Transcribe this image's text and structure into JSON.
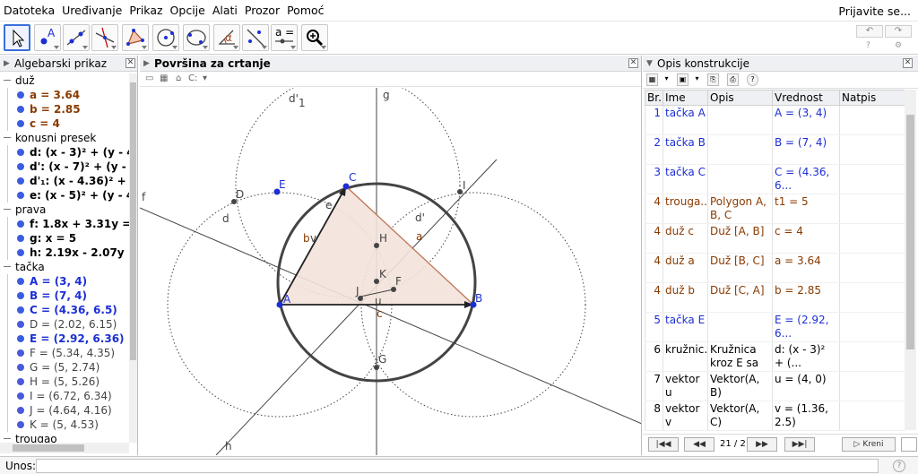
{
  "menu": {
    "items": [
      "Datoteka",
      "Uređivanje",
      "Prikaz",
      "Opcije",
      "Alati",
      "Prozor",
      "Pomoć"
    ],
    "signin": "Prijavite se..."
  },
  "toolbar": {
    "tools": [
      {
        "name": "move-tool-icon"
      },
      {
        "name": "point-tool-icon"
      },
      {
        "name": "line-tool-icon"
      },
      {
        "name": "perpendicular-tool-icon"
      },
      {
        "name": "polygon-tool-icon"
      },
      {
        "name": "circle-tool-icon"
      },
      {
        "name": "conic-tool-icon"
      },
      {
        "name": "angle-tool-icon"
      },
      {
        "name": "reflect-tool-icon"
      },
      {
        "name": "slider-tool-icon",
        "label": "a = 2"
      },
      {
        "name": "zoom-tool-icon"
      }
    ]
  },
  "algebra": {
    "title": "Algebarski prikaz",
    "rows": [
      {
        "kind": "cat",
        "text": "duž"
      },
      {
        "kind": "item",
        "text": "a = 3.64",
        "color": "#8a3a00"
      },
      {
        "kind": "item",
        "text": "b = 2.85",
        "color": "#8a3a00"
      },
      {
        "kind": "item",
        "text": "c = 4",
        "color": "#8a3a00"
      },
      {
        "kind": "cat",
        "text": "konusni presek"
      },
      {
        "kind": "item",
        "text": "d: (x - 3)² + (y - 4)² =",
        "color": "#000000"
      },
      {
        "kind": "item",
        "text": "d': (x - 7)² + (y - 4)² =",
        "color": "#000000"
      },
      {
        "kind": "item",
        "text": "d'₁: (x - 4.36)² + (y -",
        "color": "#000000"
      },
      {
        "kind": "item",
        "text": "e: (x - 5)² + (y - 4.53",
        "color": "#000000"
      },
      {
        "kind": "cat",
        "text": "prava"
      },
      {
        "kind": "item",
        "text": "f: 1.8x + 3.31y = 24.",
        "color": "#000000"
      },
      {
        "kind": "item",
        "text": "g: x = 5",
        "color": "#000000"
      },
      {
        "kind": "item",
        "text": "h: 2.19x - 2.07y = 1",
        "color": "#000000"
      },
      {
        "kind": "cat",
        "text": "tačka"
      },
      {
        "kind": "item",
        "text": "A = (3, 4)",
        "color": "#1c2fd4"
      },
      {
        "kind": "item",
        "text": "B = (7, 4)",
        "color": "#1c2fd4"
      },
      {
        "kind": "item",
        "text": "C = (4.36, 6.5)",
        "color": "#1c2fd4"
      },
      {
        "kind": "item",
        "text": "D = (2.02, 6.15)",
        "color": "#444444",
        "light": true
      },
      {
        "kind": "item",
        "text": "E = (2.92, 6.36)",
        "color": "#1c2fd4"
      },
      {
        "kind": "item",
        "text": "F = (5.34, 4.35)",
        "color": "#444444",
        "light": true
      },
      {
        "kind": "item",
        "text": "G = (5, 2.74)",
        "color": "#444444",
        "light": true
      },
      {
        "kind": "item",
        "text": "H = (5, 5.26)",
        "color": "#444444",
        "light": true
      },
      {
        "kind": "item",
        "text": "I = (6.72, 6.34)",
        "color": "#444444",
        "light": true
      },
      {
        "kind": "item",
        "text": "J = (4.64, 4.16)",
        "color": "#444444",
        "light": true
      },
      {
        "kind": "item",
        "text": "K = (5, 4.53)",
        "color": "#444444",
        "light": true
      },
      {
        "kind": "cat",
        "text": "trougao"
      }
    ]
  },
  "graphics": {
    "title": "Površina za crtanje",
    "style_label": "C:",
    "labels": {
      "A": "A",
      "B": "B",
      "C": "C",
      "D": "D",
      "E": "E",
      "F": "F",
      "G": "G",
      "H": "H",
      "I": "I",
      "J": "J",
      "K": "K",
      "a": "a",
      "b": "b",
      "c": "c",
      "d": "d",
      "d_prime": "d'",
      "d1": "d'",
      "d1_sub": "1",
      "e": "e",
      "f": "f",
      "g": "g",
      "h": "h",
      "u": "u",
      "v": "v"
    },
    "colors": {
      "point": "#1c2fd4",
      "triangle_fill": "#f3e3dc",
      "triangle_stroke": "#c07a5a",
      "circle": "#444444",
      "label_brown": "#8a3a00"
    }
  },
  "construction": {
    "title": "Opis konstrukcije",
    "columns": [
      "Br.",
      "Ime",
      "Opis",
      "Vrednost",
      "Natpis"
    ],
    "rows": [
      {
        "br": "1",
        "ime": "tačka A",
        "opis": "",
        "vrednost": "A = (3, 4)",
        "color": "c-blue"
      },
      {
        "br": "2",
        "ime": "tačka B",
        "opis": "",
        "vrednost": "B = (7, 4)",
        "color": "c-blue"
      },
      {
        "br": "3",
        "ime": "tačka C",
        "opis": "",
        "vrednost": "C = (4.36, 6...",
        "color": "c-blue"
      },
      {
        "br": "4",
        "ime": "trouga...",
        "opis": "Polygon A, B, C",
        "vrednost": "t1 = 5",
        "color": "c-brown"
      },
      {
        "br": "4",
        "ime": "duž c",
        "opis": "Duž [A, B]",
        "vrednost": "c = 4",
        "color": "c-brown"
      },
      {
        "br": "4",
        "ime": "duž a",
        "opis": "Duž [B, C]",
        "vrednost": "a = 3.64",
        "color": "c-brown"
      },
      {
        "br": "4",
        "ime": "duž b",
        "opis": "Duž [C, A]",
        "vrednost": "b = 2.85",
        "color": "c-brown"
      },
      {
        "br": "5",
        "ime": "tačka E",
        "opis": "",
        "vrednost": "E = (2.92, 6...",
        "color": "c-blue"
      },
      {
        "br": "6",
        "ime": "kružnic...",
        "opis": "Kružnica kroz E sa",
        "vrednost": "d: (x - 3)² + (...",
        "color": "c-black"
      },
      {
        "br": "7",
        "ime": "vektor u",
        "opis": "Vektor(A, B)",
        "vrednost": "u = (4, 0)",
        "color": "c-black"
      },
      {
        "br": "8",
        "ime": "vektor v",
        "opis": "Vektor(A, C)",
        "vrednost": "v = (1.36, 2.5)",
        "color": "c-black"
      }
    ],
    "nav": {
      "first": "|◀◀",
      "prev": "◀◀",
      "counter": "21 / 21",
      "next": "▶▶",
      "last": "▶▶|",
      "play": "▷ Kreni"
    }
  },
  "inputbar": {
    "label": "Unos:",
    "value": ""
  }
}
